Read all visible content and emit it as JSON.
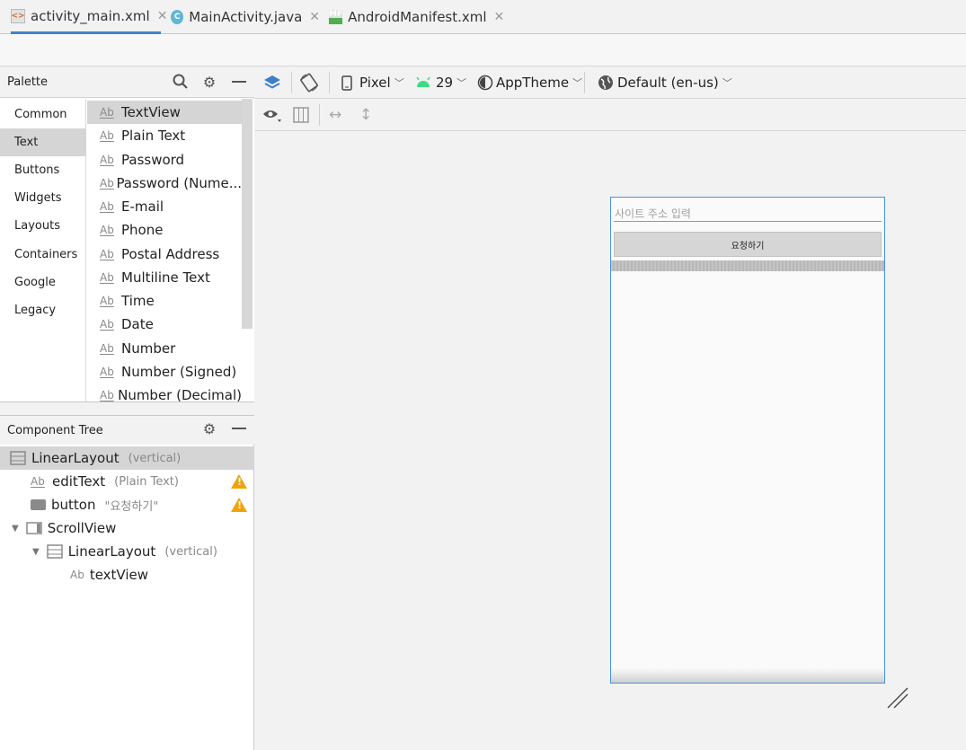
{
  "tabs": [
    {
      "label": "activity_main.xml",
      "icon": "layout-xml-icon",
      "active": true
    },
    {
      "label": "MainActivity.java",
      "icon": "java-class-icon",
      "active": false
    },
    {
      "label": "AndroidManifest.xml",
      "icon": "manifest-icon",
      "active": false
    }
  ],
  "palette": {
    "title": "Palette",
    "categories": [
      "Common",
      "Text",
      "Buttons",
      "Widgets",
      "Layouts",
      "Containers",
      "Google",
      "Legacy"
    ],
    "selected_category": "Text",
    "items": [
      "TextView",
      "Plain Text",
      "Password",
      "Password (Nume...",
      "E-mail",
      "Phone",
      "Postal Address",
      "Multiline Text",
      "Time",
      "Date",
      "Number",
      "Number (Signed)",
      "Number (Decimal)"
    ],
    "selected_item": "TextView",
    "item_icon_text": "Ab"
  },
  "component_tree": {
    "title": "Component Tree",
    "nodes": [
      {
        "label": "LinearLayout",
        "sub": "(vertical)"
      },
      {
        "label": "editText",
        "sub": "(Plain Text)",
        "warning": true
      },
      {
        "label": "button",
        "sub": "\"요청하기\"",
        "warning": true
      },
      {
        "label": "ScrollView",
        "sub": ""
      },
      {
        "label": "LinearLayout",
        "sub": "(vertical)"
      },
      {
        "label": "textView",
        "sub": ""
      }
    ]
  },
  "toolbar": {
    "device": "Pixel",
    "api": "29",
    "theme": "AppTheme",
    "locale": "Default (en-us)"
  },
  "preview": {
    "edit_hint": "사이트 주소 입력",
    "button_label": "요청하기"
  },
  "colors": {
    "accent": "#4083c9",
    "selection": "#d5d5d5",
    "warning": "#f0a30a",
    "android_green": "#3ddc84"
  }
}
